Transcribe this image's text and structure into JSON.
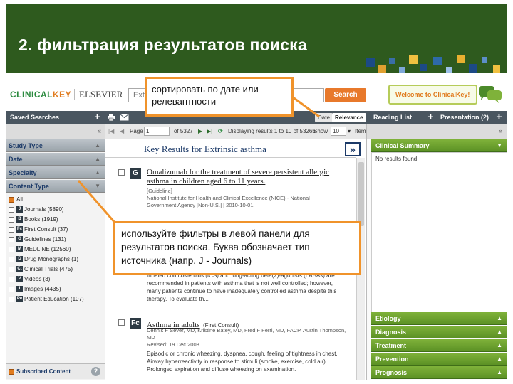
{
  "slide": {
    "title": "2. фильтрация результатов поиска",
    "accent_color": "#2e5a1e"
  },
  "header": {
    "logo_part1": "CLINICAL",
    "logo_part2": "KEY",
    "publisher": "ELSEVIER",
    "search_value": "Ext",
    "search_button": "Search",
    "welcome": "Welcome to ClinicalKey!"
  },
  "toolbar": {
    "saved_searches": "Saved Searches",
    "sort_date": "Date",
    "sort_relevance": "Relevance",
    "reading_list": "Reading List",
    "presentation": "Presentation (2)"
  },
  "pager": {
    "page_label": "Page",
    "page_value": "1",
    "of_label": "of 5327",
    "displaying": "Displaying results 1 to 10 of 53265",
    "show_label": "Show",
    "show_value": "10",
    "items_label": "Items"
  },
  "left_panel": {
    "facets": [
      "Study Type",
      "Date",
      "Specialty",
      "Content Type"
    ],
    "content_types": [
      {
        "letter": "",
        "label": "All",
        "checked": true
      },
      {
        "letter": "J",
        "label": "Journals (5890)",
        "checked": false
      },
      {
        "letter": "B",
        "label": "Books (1919)",
        "checked": false
      },
      {
        "letter": "Fc",
        "label": "First Consult (37)",
        "checked": false
      },
      {
        "letter": "G",
        "label": "Guidelines (131)",
        "checked": false
      },
      {
        "letter": "M",
        "label": "MEDLINE (12560)",
        "checked": false
      },
      {
        "letter": "D",
        "label": "Drug Monographs (1)",
        "checked": false
      },
      {
        "letter": "Ct",
        "label": "Clinical Trials (475)",
        "checked": false
      },
      {
        "letter": "V",
        "label": "Videos (3)",
        "checked": false
      },
      {
        "letter": "I",
        "label": "Images (4435)",
        "checked": false
      },
      {
        "letter": "Pe",
        "label": "Patient Education (107)",
        "checked": false
      }
    ],
    "subscribed": "Subscribed Content",
    "help": "?"
  },
  "main": {
    "key_results": "Key Results for Extrinsic asthma",
    "results": [
      {
        "letter": "G",
        "title": "Omalizumab for the treatment of severe persistent allergic asthma in children aged 6 to 11 years.",
        "type": "[Guideline]",
        "source": "National Institute for Health and Clinical Excellence (NICE) - National Government Agency [Non-U.S.] | 2010-10-01"
      },
      {
        "letter": "J",
        "snippet": "Inhaled corticosteroids (ICS) and long-acting beta(2)-agonists (LABAs) are recommended in patients with asthma that is not well controlled; however, many patients continue to have inadequately controlled asthma despite this therapy. To evaluate th..."
      },
      {
        "letter": "Fc",
        "title": "Asthma in adults",
        "type": "(First Consult)",
        "authors": "Dennis F Sever, MD, Kristine Batey, MD, Fred F Ferri, MD, FACP, Austin Thompson, MD",
        "revised": "Revised: 19 Dec 2008",
        "snippet": "Episodic or chronic wheezing, dyspnea, cough, feeling of tightness in chest. Airway hyperreactivity in response to stimuli (smoke, exercise, cold air). Prolonged expiration and diffuse wheezing on examination."
      }
    ]
  },
  "right_panel": {
    "clinical_summary": "Clinical Summary",
    "no_results": "No results found",
    "sections": [
      "Etiology",
      "Diagnosis",
      "Treatment",
      "Prevention",
      "Prognosis"
    ]
  },
  "callouts": {
    "sort": "сортировать по дате или релевантности",
    "filters": "используйте фильтры в левой панели для результатов поиска. Буква обозначает тип источника (напр. J - Journals)"
  }
}
